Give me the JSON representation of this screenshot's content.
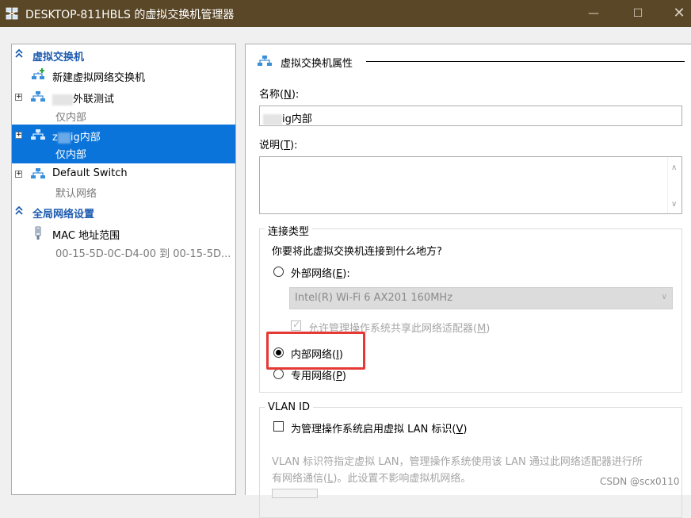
{
  "window": {
    "title": "DESKTOP-811HBLS 的虚拟交换机管理器",
    "minimize_glyph": "—",
    "maximize_glyph": "☐",
    "close_glyph": "✕"
  },
  "sidebar": {
    "section_switches": "虚拟交换机",
    "new_switch": "新建虚拟网络交换机",
    "items": [
      {
        "name_suffix": "外联测试",
        "subtitle": "仅内部"
      },
      {
        "name_prefix": "z",
        "name_suffix": "ig内部",
        "subtitle": "仅内部"
      },
      {
        "name": "Default Switch",
        "subtitle": "默认网络"
      }
    ],
    "section_global": "全局网络设置",
    "mac_range": {
      "name": "MAC 地址范围",
      "subtitle": "00-15-5D-0C-D4-00 到 00-15-5D..."
    }
  },
  "properties": {
    "heading": "虚拟交换机属性",
    "name_label": "名称(",
    "name_key": "N",
    "name_label_end": "):",
    "name_value": "ig内部",
    "notes_label": "说明(",
    "notes_key": "T",
    "notes_label_end": "):",
    "connection_group": "连接类型",
    "connection_question": "你要将此虚拟交换机连接到什么地方?",
    "external_label": "外部网络(",
    "external_key": "E",
    "external_label_end": "):",
    "adapter_value": "Intel(R) Wi-Fi 6 AX201 160MHz",
    "allow_share": "允许管理操作系统共享此网络适配器(",
    "allow_share_key": "M",
    "allow_share_end": ")",
    "internal_label": "内部网络(",
    "internal_key": "I",
    "internal_label_end": ")",
    "private_label": "专用网络(",
    "private_key": "P",
    "private_label_end": ")",
    "vlan_group": "VLAN ID",
    "vlan_enable": "为管理操作系统启用虚拟 LAN 标识(",
    "vlan_enable_key": "V",
    "vlan_enable_end": ")",
    "vlan_desc_line1": "VLAN 标识符指定虚拟 LAN，管理操作系统使用该 LAN 通过此网络适配器进行所",
    "vlan_desc_line2a": "有网络通信(",
    "vlan_desc_key": "L",
    "vlan_desc_line2b": ")。此设置不影响虚拟机网络。"
  },
  "watermark": "CSDN @scx0110",
  "colors": {
    "titlebar": "#5a4727",
    "selection": "#0a74da",
    "section_header": "#1d5bb0",
    "highlight": "#e53935"
  }
}
